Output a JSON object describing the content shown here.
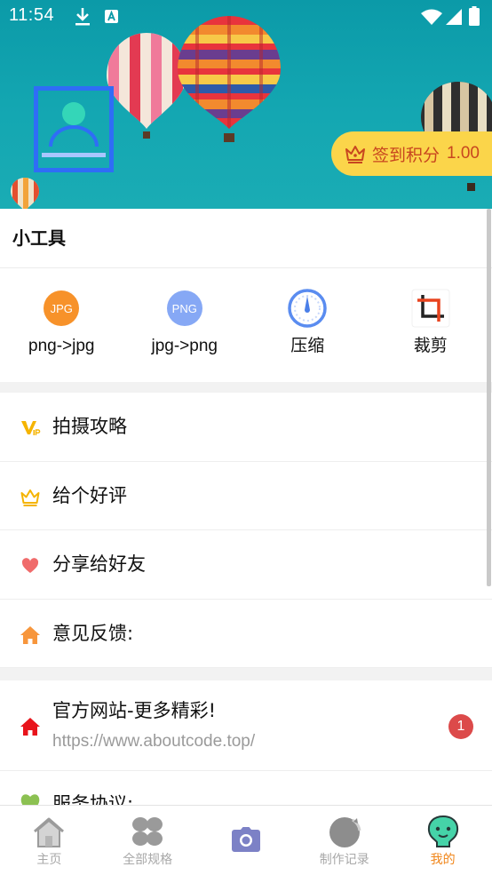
{
  "status_bar": {
    "time": "11:54"
  },
  "profile": {
    "signin_label": "签到积分",
    "signin_points": "1.00"
  },
  "tools": {
    "title": "小工具",
    "items": [
      {
        "label": "png->jpg",
        "badge": "JPG",
        "icon": "jpg-icon"
      },
      {
        "label": "jpg->png",
        "badge": "PNG",
        "icon": "png-icon"
      },
      {
        "label": "压缩",
        "icon": "gauge-icon"
      },
      {
        "label": "裁剪",
        "icon": "crop-icon"
      }
    ]
  },
  "menu": {
    "items": [
      {
        "label": "拍摄攻略",
        "icon": "vip-icon"
      },
      {
        "label": "给个好评",
        "icon": "crown-icon"
      },
      {
        "label": "分享给好友",
        "icon": "heart-icon"
      },
      {
        "label": "意见反馈:",
        "icon": "home-icon"
      }
    ]
  },
  "links": {
    "website": {
      "title": "官方网站-更多精彩!",
      "url": "https://www.aboutcode.top/",
      "badge": "1",
      "icon": "home-red-icon"
    },
    "agreement": {
      "title": "服务协议:",
      "icon": "leaf-icon"
    }
  },
  "bottom_nav": {
    "items": [
      {
        "label": "主页",
        "icon": "house-icon"
      },
      {
        "label": "全部规格",
        "icon": "clover-icon"
      },
      {
        "label": "",
        "icon": "camera-icon"
      },
      {
        "label": "制作记录",
        "icon": "record-icon"
      },
      {
        "label": "我的",
        "icon": "face-icon",
        "active": true
      }
    ]
  },
  "colors": {
    "header_bg": "#12a3ae",
    "signin_bg": "#fbd54a",
    "signin_text": "#c8461f",
    "active_nav": "#f08519",
    "badge_red": "#dc4a4a"
  }
}
